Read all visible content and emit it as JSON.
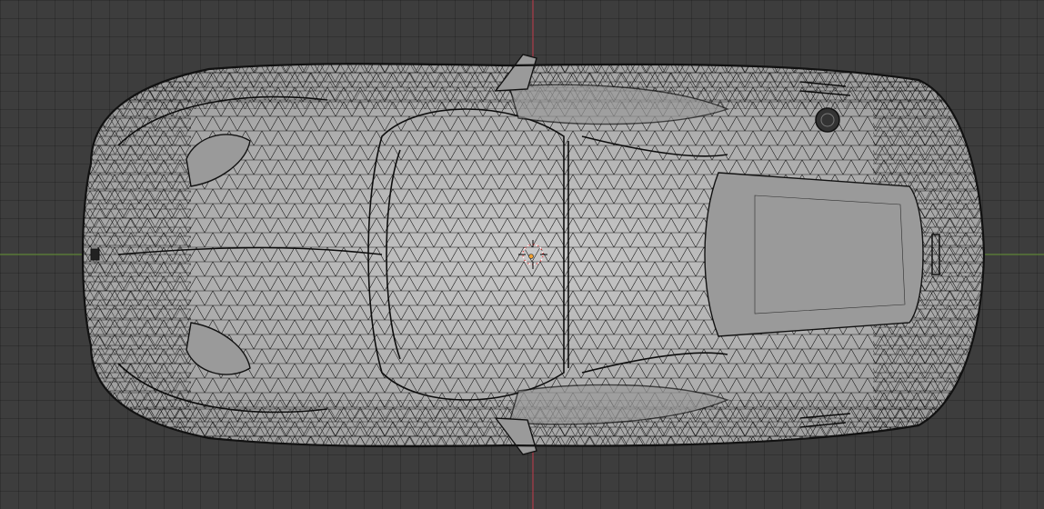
{
  "viewport": {
    "view": "top-orthographic",
    "shading": "wireframe-overlay",
    "object": "sports car mesh"
  },
  "colors": {
    "background": "#3d3d3d",
    "grid_line": "#2e2e2e",
    "x_axis": "#6c9a3a",
    "y_axis": "#c23b4a",
    "mesh_surface": "#b9b9b9",
    "wire": "#1a1a1a"
  },
  "icons": {
    "cursor": "3d-cursor-icon",
    "origin": "object-origin-icon"
  }
}
